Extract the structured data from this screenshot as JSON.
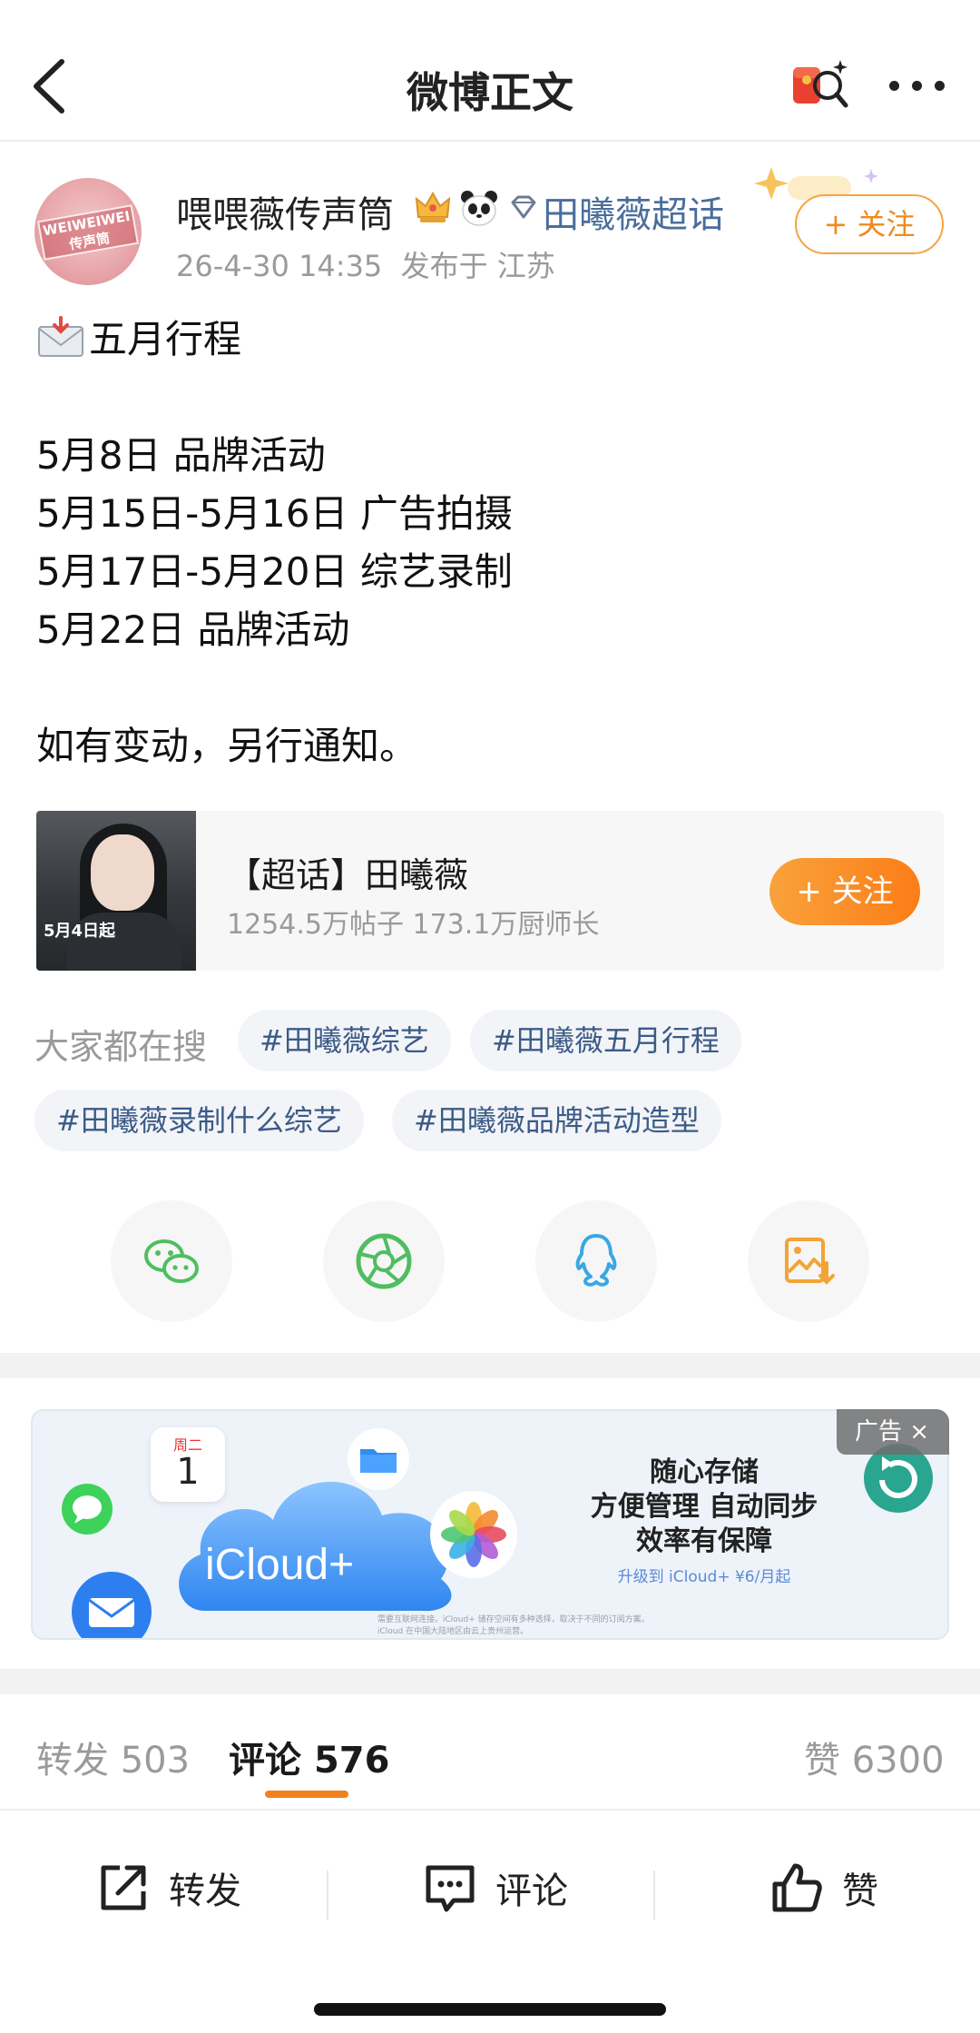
{
  "header": {
    "title": "微博正文"
  },
  "post": {
    "author": "喂喂薇传声筒",
    "avatar_text": "WEIWEIWEI 传声筒",
    "supertopic_link": "田曦薇超话",
    "timestamp": "26-4-30 14:35",
    "published_from": "发布于 江苏",
    "follow_label": "+ 关注",
    "heading": "五月行程",
    "lines": [
      "5月8日 品牌活动",
      "5月15日-5月16日 广告拍摄",
      "5月17日-5月20日 综艺录制",
      "5月22日 品牌活动"
    ],
    "closing": "如有变动，另行通知。"
  },
  "supertopic_card": {
    "title": "【超话】田曦薇",
    "stats": "1254.5万帖子 173.1万厨师长",
    "follow_label": "+ 关注",
    "poster_date": "5月4日起"
  },
  "search": {
    "label": "大家都在搜",
    "tags": [
      "#田曦薇综艺",
      "#田曦薇五月行程",
      "#田曦薇录制什么综艺",
      "#田曦薇品牌活动造型"
    ]
  },
  "share": {
    "icons": [
      "wechat-icon",
      "moments-icon",
      "qq-icon",
      "save-image-icon"
    ]
  },
  "ad": {
    "badge": "广告 ×",
    "brand": "iCloud+",
    "calendar_day": "周二",
    "calendar_date": "1",
    "lines": [
      "随心存储",
      "方便管理 自动同步",
      "效率有保障"
    ],
    "sub": "升级到 iCloud+ ¥6/月起",
    "fine_print": "需要互联网连接。iCloud+ 储存空间有多种选择，取决于不同的订阅方案。iCloud 在中国大陆地区由云上贵州运营。"
  },
  "stats": {
    "repost_label": "转发",
    "repost_count": "503",
    "comment_label": "评论",
    "comment_count": "576",
    "like_label": "赞",
    "like_count": "6300"
  },
  "actions": {
    "repost": "转发",
    "comment": "评论",
    "like": "赞"
  },
  "colors": {
    "accent_orange": "#fb7d18",
    "link_blue": "#4a6e9c"
  }
}
